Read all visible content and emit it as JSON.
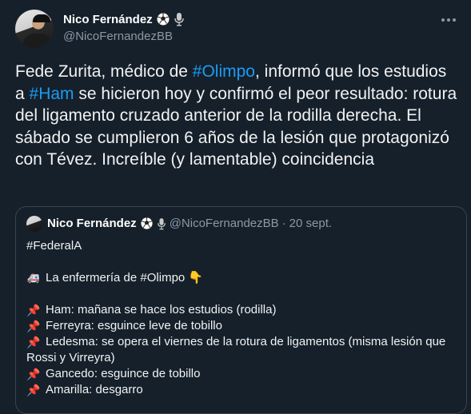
{
  "author": {
    "name": "Nico Fernández",
    "handle": "@NicoFernandezBB",
    "badges": [
      "soccer-ball-icon",
      "microphone-icon"
    ]
  },
  "menu_icon": "more-options-icon",
  "tweet": {
    "parts": [
      "Fede Zurita, médico de ",
      "#Olimpo",
      ", informó que los estudios a ",
      "#Ham",
      " se hicieron hoy y confirmó el peor resultado: rotura del ligamento cruzado anterior de la rodilla derecha. El sábado se cumplieron 6 años de la lesión que protagonizó con Tévez. Increíble (y lamentable) coincidencia"
    ]
  },
  "quote": {
    "name": "Nico Fernández",
    "handle": "@NicoFernandezBB",
    "separator": "·",
    "date": "20 sept.",
    "hashtag": "#FederalA",
    "heading": "La enfermería de #Olimpo",
    "items": [
      "Ham: mañana se hace los estudios (rodilla)",
      "Ferreyra: esguince leve de tobillo",
      "Ledesma: se opera el viernes de la rotura de ligamentos (misma lesión que Rossi y Virreyra)",
      "Gancedo: esguince de tobillo",
      "Amarilla: desgarro"
    ]
  },
  "colors": {
    "background": "#15202b",
    "link": "#1d9bf0",
    "secondary_text": "#8b98a5",
    "border": "#38444d"
  }
}
